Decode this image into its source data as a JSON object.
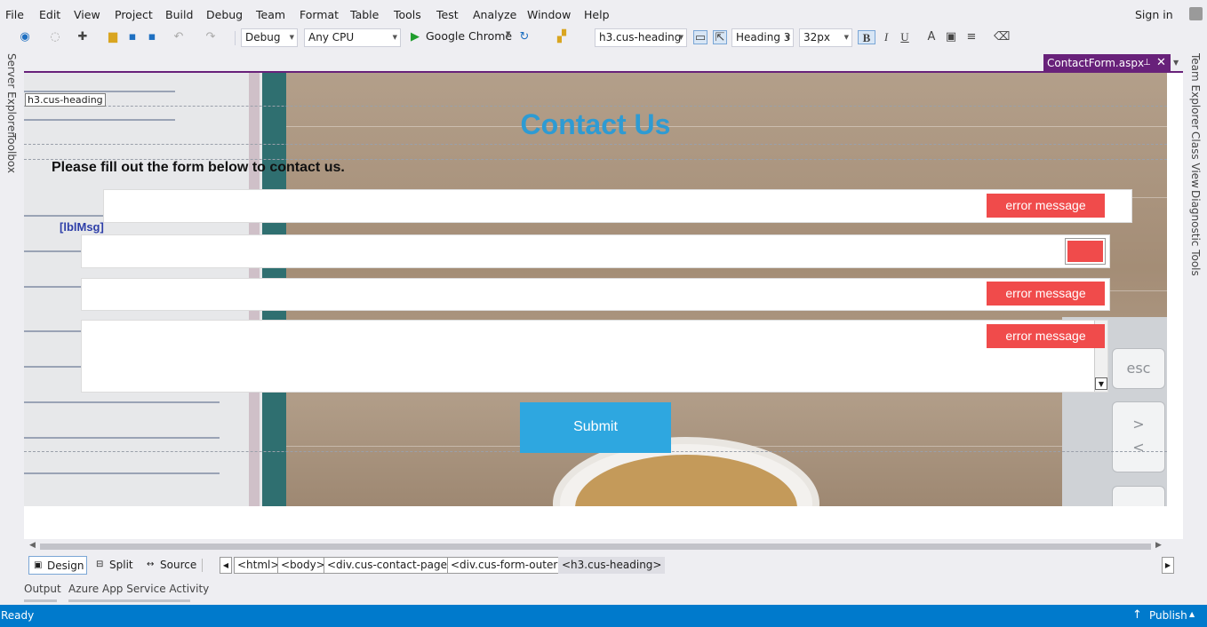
{
  "menu": [
    "File",
    "Edit",
    "View",
    "Project",
    "Build",
    "Debug",
    "Team",
    "Format",
    "Table",
    "Tools",
    "Test",
    "Analyze",
    "Window",
    "Help"
  ],
  "account": {
    "sign_in": "Sign in"
  },
  "toolbar": {
    "config": "Debug",
    "platform": "Any CPU",
    "run_target": "Google Chrome",
    "style_selector": "h3.cus-heading",
    "block_format": "Heading 3",
    "font_size": "32px",
    "bold": "B",
    "italic": "I",
    "underline": "U"
  },
  "left_sidebar": [
    "Server Explorer",
    "Toolbox"
  ],
  "right_sidebar": [
    "Team Explorer",
    "Class View",
    "Diagnostic Tools"
  ],
  "document_tab": {
    "name": "ContactForm.aspx"
  },
  "page": {
    "element_tag": "h3.cus-heading",
    "heading": "Contact Us",
    "intro": "Please fill out the form below to contact us.",
    "label_msg": "[lblMsg]",
    "error_text": "error message",
    "submit": "Submit",
    "keyboard_keys": [
      "esc",
      ">",
      "<"
    ]
  },
  "view_tabs": [
    "Design",
    "Split",
    "Source"
  ],
  "breadcrumbs": [
    "<html>",
    "<body>",
    "<div.cus-contact-page>",
    "<div.cus-form-outer>",
    "<h3.cus-heading>"
  ],
  "bottom_tabs": [
    "Output",
    "Azure App Service Activity"
  ],
  "status": {
    "text": "Ready",
    "publish": "Publish"
  },
  "colors": {
    "accent": "#68217a",
    "status_bar": "#007acc",
    "heading": "#2e9bd3",
    "error": "#f04b4b",
    "submit": "#2ea7e0"
  }
}
